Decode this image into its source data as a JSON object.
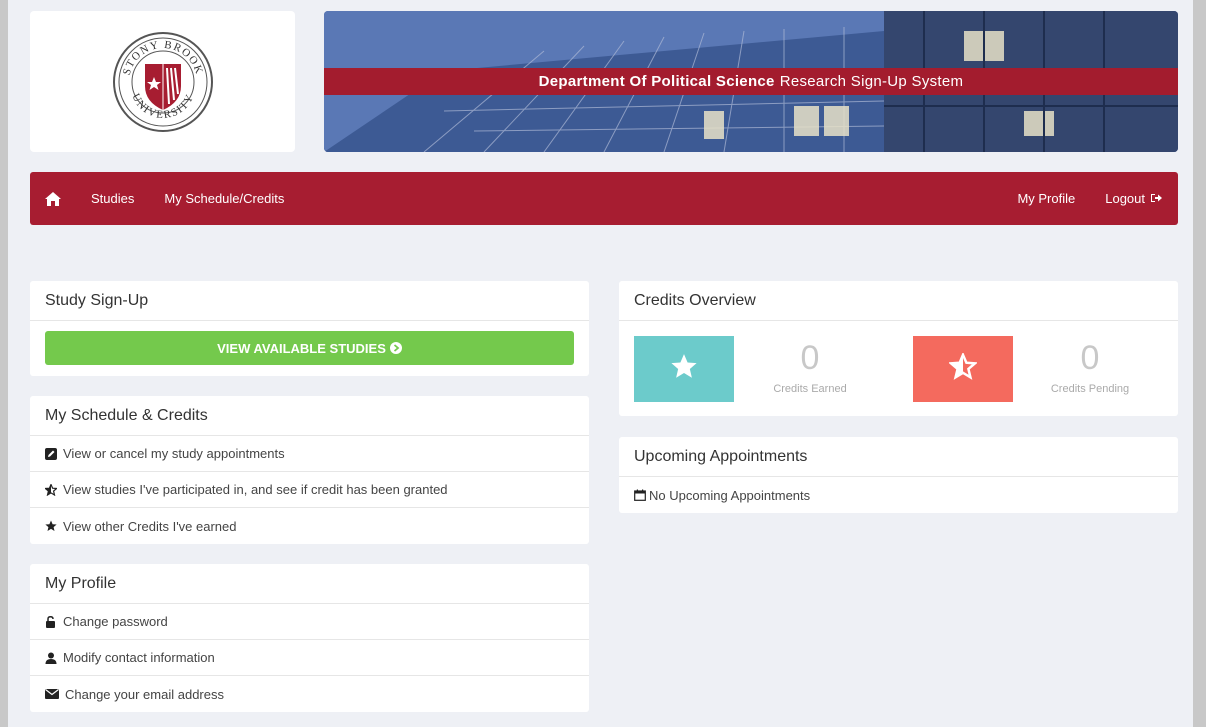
{
  "banner": {
    "title_bold": "Department Of Political Science",
    "title_rest": "Research Sign-Up System"
  },
  "nav": {
    "home_icon": "home-icon",
    "studies": "Studies",
    "schedule": "My Schedule/Credits",
    "profile": "My Profile",
    "logout": "Logout"
  },
  "study_signup": {
    "title": "Study Sign-Up",
    "button": "VIEW AVAILABLE STUDIES"
  },
  "schedule": {
    "title": "My Schedule & Credits",
    "items": [
      {
        "label": "View or cancel my study appointments",
        "icon": "edit-icon"
      },
      {
        "label": "View studies I've participated in, and see if credit has been granted",
        "icon": "half-star-icon"
      },
      {
        "label": "View other Credits I've earned",
        "icon": "star-icon"
      }
    ]
  },
  "profile": {
    "title": "My Profile",
    "items": [
      {
        "label": "Change password",
        "icon": "unlock-icon"
      },
      {
        "label": "Modify contact information",
        "icon": "user-icon"
      },
      {
        "label": "Change your email address",
        "icon": "envelope-icon"
      }
    ]
  },
  "credits": {
    "title": "Credits Overview",
    "earned_value": "0",
    "earned_label": "Credits Earned",
    "pending_value": "0",
    "pending_label": "Credits Pending",
    "earned_color": "#6ccbcb",
    "pending_color": "#f46a5e"
  },
  "appointments": {
    "title": "Upcoming Appointments",
    "empty": "No Upcoming Appointments"
  },
  "colors": {
    "brand_red": "#a71d31",
    "button_green": "#74c94c"
  }
}
